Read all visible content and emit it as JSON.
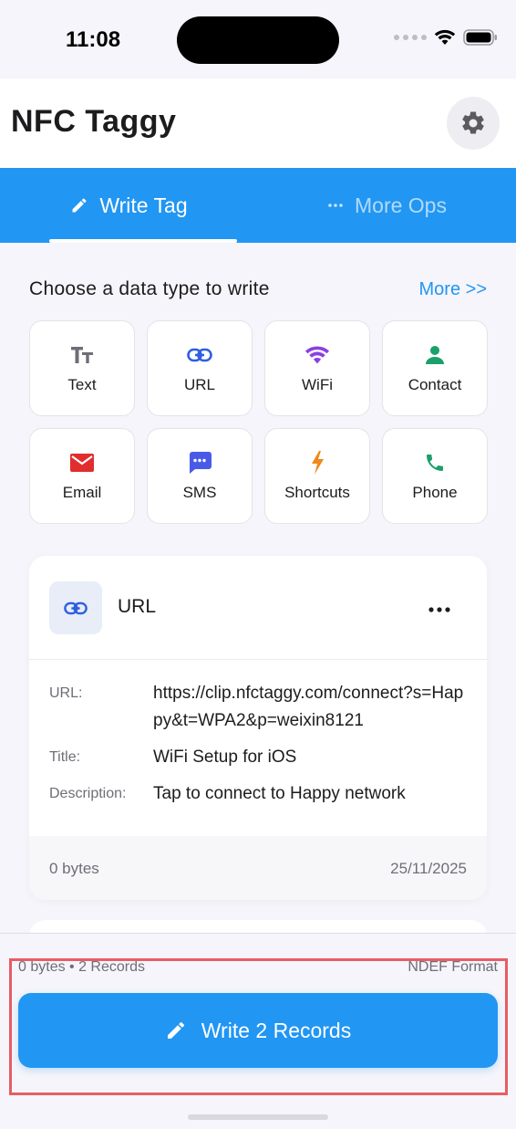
{
  "status_bar": {
    "time": "11:08"
  },
  "header": {
    "title": "NFC Taggy"
  },
  "tabs": [
    {
      "label": "Write Tag",
      "active": true
    },
    {
      "label": "More Ops",
      "active": false
    }
  ],
  "section": {
    "title": "Choose a data type to write",
    "more_label": "More >>"
  },
  "data_types": [
    {
      "label": "Text",
      "icon": "text-size-icon",
      "color": "#6e6e76"
    },
    {
      "label": "URL",
      "icon": "link-icon",
      "color": "#2f5fe0"
    },
    {
      "label": "WiFi",
      "icon": "wifi-icon",
      "color": "#8b3fe0"
    },
    {
      "label": "Contact",
      "icon": "person-icon",
      "color": "#1aa06a"
    },
    {
      "label": "Email",
      "icon": "envelope-icon",
      "color": "#e02e2e"
    },
    {
      "label": "SMS",
      "icon": "chat-bubble-icon",
      "color": "#4a5ae8"
    },
    {
      "label": "Shortcuts",
      "icon": "bolt-icon",
      "color": "#f0881a"
    },
    {
      "label": "Phone",
      "icon": "phone-icon",
      "color": "#1aa06a"
    }
  ],
  "record_card": {
    "type": "URL",
    "fields": [
      {
        "label": "URL:",
        "value": "https://clip.nfctaggy.com/connect?s=Happy&t=WPA2&p=weixin8121"
      },
      {
        "label": "Title:",
        "value": "WiFi Setup for iOS"
      },
      {
        "label": "Description:",
        "value": "Tap to connect to Happy network"
      }
    ],
    "size": "0 bytes",
    "date": "25/11/2025"
  },
  "bottom_bar": {
    "summary": "0 bytes • 2 Records",
    "format": "NDEF Format",
    "write_label": "Write 2 Records"
  },
  "colors": {
    "accent": "#2196f3",
    "highlight": "#e85d63"
  }
}
